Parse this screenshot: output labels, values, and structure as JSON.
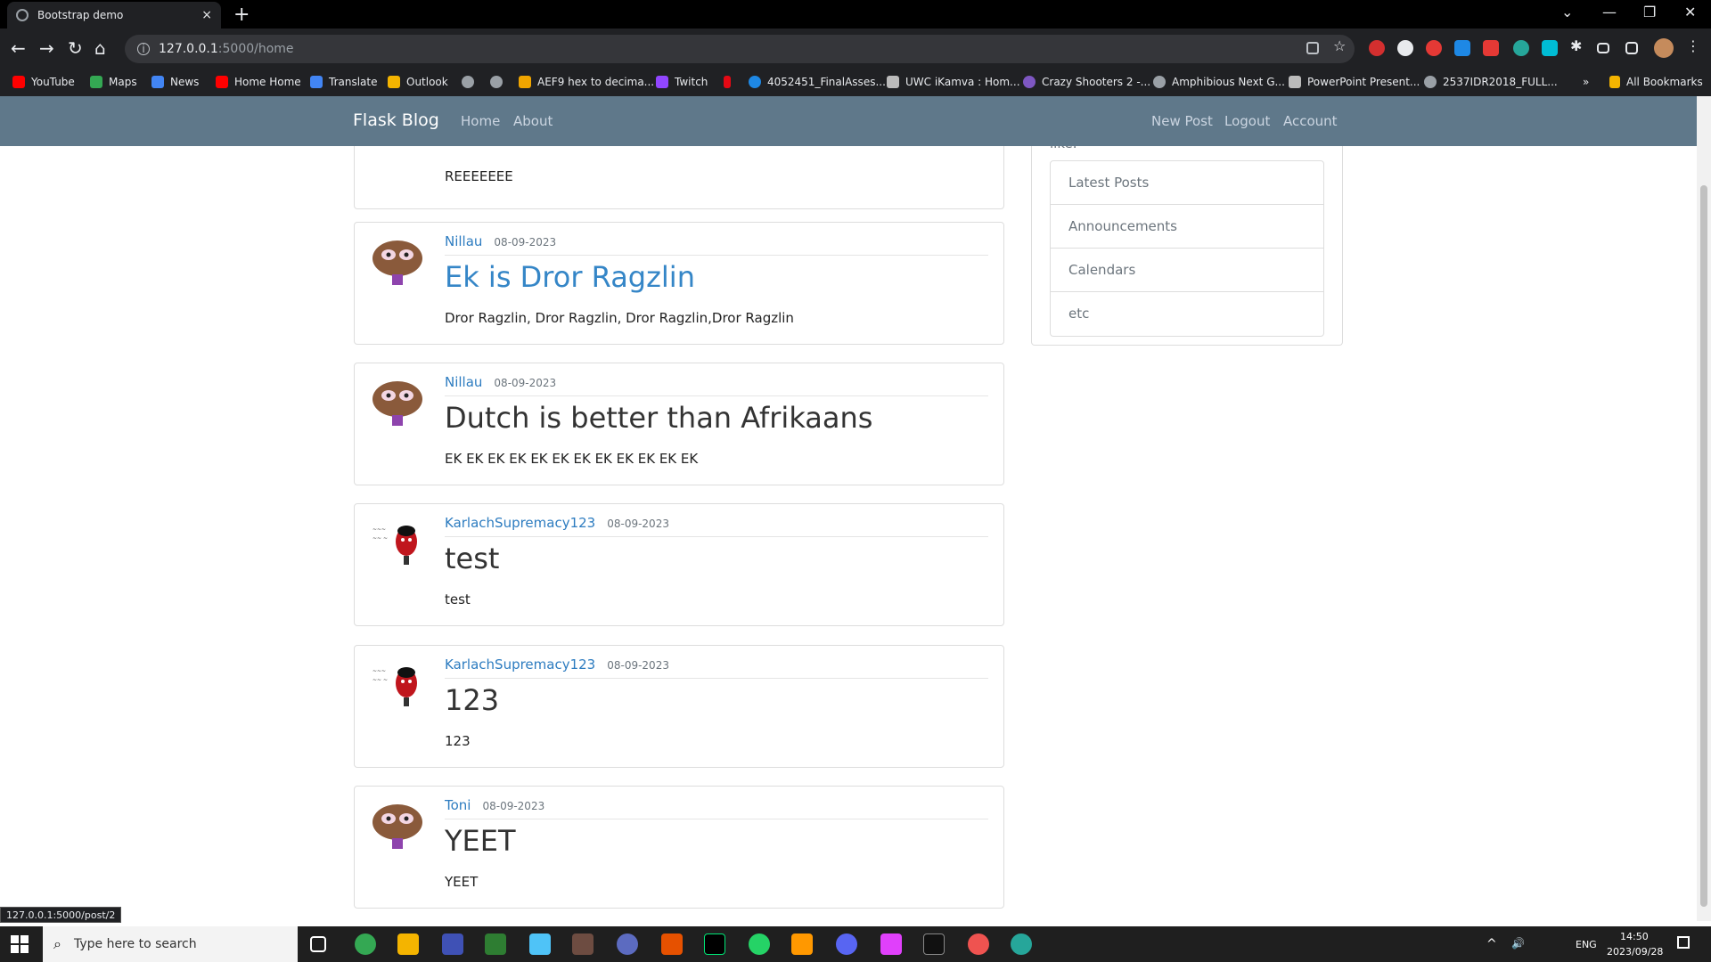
{
  "browser": {
    "tab_title": "Bootstrap demo",
    "tab_close": "×",
    "new_tab": "+",
    "url_host": "127.0.0.1",
    "url_path": ":5000/home",
    "controls": {
      "minimize": "⌄",
      "min": "—",
      "restore": "❐",
      "close": "✕"
    },
    "nav": {
      "back": "←",
      "forward": "→",
      "reload": "↻",
      "home": "⌂"
    },
    "bookmarks": [
      {
        "label": "YouTube",
        "color": "#ff0000"
      },
      {
        "label": "Maps",
        "color": "#34a853"
      },
      {
        "label": "News",
        "color": "#4285f4"
      },
      {
        "label": "Home Home",
        "color": "#ff0000"
      },
      {
        "label": "Translate",
        "color": "#4285f4"
      },
      {
        "label": "Outlook",
        "color": "#f4b400"
      },
      {
        "label": "",
        "color": "#9aa0a6"
      },
      {
        "label": "",
        "color": "#9aa0a6"
      },
      {
        "label": "AEF9 hex to decima...",
        "color": "#f0a500"
      },
      {
        "label": "Twitch",
        "color": "#9146ff"
      },
      {
        "label": "",
        "color": "#e50914"
      },
      {
        "label": "4052451_FinalAsses...",
        "color": "#1e88e5"
      },
      {
        "label": "UWC iKamva : Hom...",
        "color": "#bbbbbb"
      },
      {
        "label": "Crazy Shooters 2 -...",
        "color": "#7e57c2"
      },
      {
        "label": "Amphibious Next G...",
        "color": "#9aa0a6"
      },
      {
        "label": "PowerPoint Present...",
        "color": "#bbbbbb"
      },
      {
        "label": "2537IDR2018_FULL...",
        "color": "#9aa0a6"
      }
    ],
    "bookmarks_more": "»",
    "all_bookmarks": "All Bookmarks",
    "status_url": "127.0.0.1:5000/post/2"
  },
  "navbar": {
    "brand": "Flask Blog",
    "left": [
      "Home",
      "About"
    ],
    "right": [
      "New Post",
      "Logout",
      "Account"
    ]
  },
  "posts": [
    {
      "author": "",
      "date": "",
      "title": "",
      "body": "REEEEEEE",
      "avatar": "brown"
    },
    {
      "author": "Nillau",
      "date": "08-09-2023",
      "title": "Ek is Dror Ragzlin",
      "body": "Dror Ragzlin, Dror Ragzlin, Dror Ragzlin,Dror Ragzlin",
      "avatar": "brown"
    },
    {
      "author": "Nillau",
      "date": "08-09-2023",
      "title": "Dutch is better than Afrikaans",
      "body": "EK EK EK EK EK EK EK EK EK EK EK EK",
      "avatar": "brown"
    },
    {
      "author": "KarlachSupremacy123",
      "date": "08-09-2023",
      "title": "test",
      "body": "test",
      "avatar": "red"
    },
    {
      "author": "KarlachSupremacy123",
      "date": "08-09-2023",
      "title": "123",
      "body": "123",
      "avatar": "red"
    },
    {
      "author": "Toni",
      "date": "08-09-2023",
      "title": "YEET",
      "body": "YEET",
      "avatar": "brown"
    }
  ],
  "sidebar": {
    "text": "like.",
    "items": [
      "Latest Posts",
      "Announcements",
      "Calendars",
      "etc"
    ]
  },
  "taskbar": {
    "search_placeholder": "Type here to search",
    "time": "14:50",
    "date": "2023/09/28",
    "lang": "ENG"
  }
}
